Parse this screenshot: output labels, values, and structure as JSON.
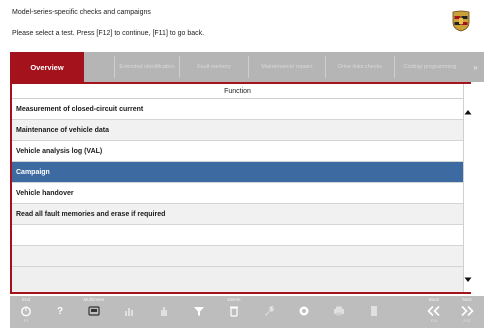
{
  "header": {
    "title": "Model-series-specific checks and campaigns",
    "instruction": "Please select a test. Press [F12] to continue, [F11] to go back."
  },
  "tabs": [
    {
      "label": "Overview",
      "active": true
    },
    {
      "label": "",
      "active": false
    },
    {
      "label": "Extended identification",
      "active": false
    },
    {
      "label": "Fault memory",
      "active": false
    },
    {
      "label": "Maintenance/ repairs",
      "active": false
    },
    {
      "label": "Drive links checks",
      "active": false
    },
    {
      "label": "Coding/ programming",
      "active": false
    }
  ],
  "table": {
    "column_header": "Function",
    "rows": [
      {
        "label": "Measurement of closed-circuit current",
        "selected": false
      },
      {
        "label": "Maintenance of vehicle data",
        "selected": false
      },
      {
        "label": "Vehicle analysis log (VAL)",
        "selected": false
      },
      {
        "label": "Campaign",
        "selected": true
      },
      {
        "label": "Vehicle handover",
        "selected": false
      },
      {
        "label": "Read all fault memories and erase if required",
        "selected": false
      },
      {
        "label": "",
        "selected": false
      },
      {
        "label": "",
        "selected": false
      }
    ]
  },
  "toolbar": {
    "buttons": [
      {
        "name": "end-button",
        "icon": "power-icon",
        "label": "End",
        "fkey": "F1"
      },
      {
        "name": "help-button",
        "icon": "question-icon",
        "label": "",
        "fkey": ""
      },
      {
        "name": "multimeter-button",
        "icon": "multimeter-icon",
        "label": "Multimeter",
        "fkey": ""
      },
      {
        "name": "measure-button",
        "icon": "bar-icon",
        "label": "",
        "fkey": ""
      },
      {
        "name": "hand-button",
        "icon": "hand-icon",
        "label": "",
        "fkey": ""
      },
      {
        "name": "filter-button",
        "icon": "funnel-icon",
        "label": "",
        "fkey": ""
      },
      {
        "name": "delete-button",
        "icon": "trash-icon",
        "label": "Delete",
        "fkey": ""
      },
      {
        "name": "tool-button",
        "icon": "wrench-icon",
        "label": "",
        "fkey": ""
      },
      {
        "name": "record-button",
        "icon": "circle-icon",
        "label": "",
        "fkey": ""
      },
      {
        "name": "print-button",
        "icon": "printer-icon",
        "label": "",
        "fkey": ""
      },
      {
        "name": "doc-button",
        "icon": "document-icon",
        "label": "",
        "fkey": ""
      },
      {
        "name": "back-button",
        "icon": "double-chevron-left-icon",
        "label": "Back",
        "fkey": "F11"
      },
      {
        "name": "next-button",
        "icon": "double-chevron-right-icon",
        "label": "Next",
        "fkey": "F12"
      }
    ]
  },
  "colors": {
    "accent": "#a4121c",
    "selection": "#3d6aa0",
    "toolbar": "#bdbdbd"
  }
}
